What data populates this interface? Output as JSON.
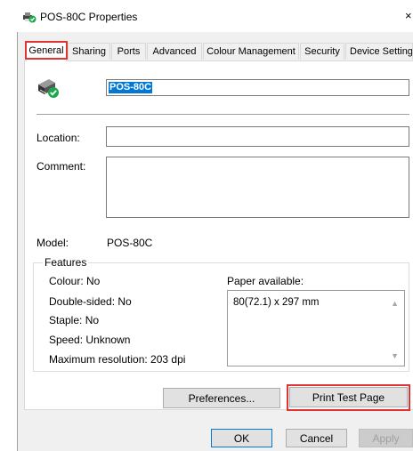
{
  "window": {
    "title": "POS-80C Properties",
    "close_glyph": "×",
    "icon": "printer-ok-icon"
  },
  "tabs": [
    {
      "label": "General",
      "active": true
    },
    {
      "label": "Sharing",
      "active": false
    },
    {
      "label": "Ports",
      "active": false
    },
    {
      "label": "Advanced",
      "active": false
    },
    {
      "label": "Colour Management",
      "active": false
    },
    {
      "label": "Security",
      "active": false
    },
    {
      "label": "Device Settings",
      "active": false
    }
  ],
  "general": {
    "printer_name": "POS-80C",
    "location_label": "Location:",
    "location_value": "",
    "comment_label": "Comment:",
    "comment_value": "",
    "model_label": "Model:",
    "model_value": "POS-80C"
  },
  "features": {
    "title": "Features",
    "colour": "Colour: No",
    "double_sided": "Double-sided: No",
    "staple": "Staple: No",
    "speed": "Speed: Unknown",
    "max_resolution": "Maximum resolution: 203 dpi",
    "paper_label": "Paper available:",
    "paper_items": [
      "80(72.1) x 297 mm"
    ]
  },
  "buttons": {
    "preferences": "Preferences...",
    "print_test_page": "Print Test Page",
    "ok": "OK",
    "cancel": "Cancel",
    "apply": "Apply"
  },
  "colors": {
    "highlight": "#e03333",
    "selection": "#0078d7",
    "status_ok": "#1ea64b"
  }
}
